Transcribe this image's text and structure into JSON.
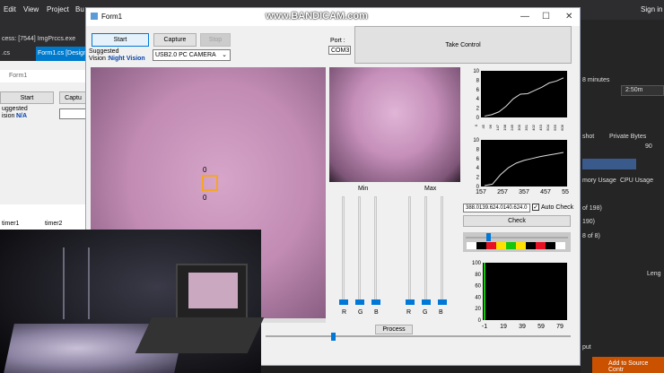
{
  "watermark": "www.BANDICAM.com",
  "ide": {
    "menu": [
      "Edit",
      "View",
      "Project",
      "Bu"
    ],
    "sign_in": "Sign in",
    "process_text": "cess:  [7544] ImgPrccs.exe",
    "tab_cs": ".cs",
    "tab_design": "Form1.cs [Design",
    "mini_form_title": "Form1",
    "mini_start": "Start",
    "mini_capt": "Captu",
    "mini_suggested": "uggested",
    "mini_vision": "ision :",
    "mini_na": "N/A",
    "timer1": "timer1",
    "timer2": "timer2",
    "minutes": "8 minutes",
    "time_value": "2:50m",
    "snapshot": "shot",
    "private_bytes": "Private Bytes",
    "value_90": "90",
    "memory_usage": "mory Usage",
    "cpu_usage": "CPU Usage",
    "of_198": "of 198)",
    "n190": "190)",
    "of_8": "8 of 8)",
    "put": "put",
    "add_source": "Add to Source Contr",
    "leng": "Leng"
  },
  "form": {
    "title": "Form1",
    "start": "Start",
    "capture": "Capture",
    "stop": "Stop",
    "port_label": "Port :",
    "port_value": "COM3",
    "take_control": "Take Control",
    "suggested_label": "Suggested",
    "vision_label": "Vision :",
    "suggested_value": "Night Vision",
    "camera_select": "USB2.0 PC CAMERA",
    "marker_top": "0",
    "marker_bottom": "0",
    "min_label": "Min",
    "max_label": "Max",
    "rgb_min": [
      "R",
      "G",
      "B"
    ],
    "rgb_max": [
      "R",
      "G",
      "B"
    ],
    "rgb_values": "388.0139.624.0140.624.0",
    "auto_check": "Auto Check",
    "check": "Check",
    "process": "Process",
    "strip_colors": [
      "#ffffff",
      "#000000",
      "#e81123",
      "#ffe100",
      "#16c60c",
      "#ffe100",
      "#000000",
      "#e81123",
      "#000000",
      "#ffffff"
    ]
  },
  "chart_data": [
    {
      "type": "line",
      "title": "",
      "y_ticks": [
        "10",
        "8",
        "6",
        "4",
        "2",
        "0"
      ],
      "x_ticks": [
        "0",
        "45",
        "96",
        "147",
        "198",
        "249",
        "300",
        "351",
        "402",
        "453",
        "504",
        "555",
        "606"
      ],
      "ylim": [
        0,
        10
      ],
      "series": [
        {
          "values_y": [
            0.3,
            0.6,
            1.2,
            2.4,
            4.0,
            5.0,
            5.1,
            5.8,
            6.5,
            7.4,
            7.8,
            8.5
          ]
        }
      ]
    },
    {
      "type": "line",
      "title": "",
      "y_ticks": [
        "10",
        "8",
        "6",
        "4",
        "2",
        "0"
      ],
      "x_ticks": [
        "157",
        "257",
        "357",
        "457",
        "557"
      ],
      "ylim": [
        0,
        10
      ],
      "series": [
        {
          "values_y": [
            0.2,
            0.5,
            2.5,
            4.0,
            5.0,
            5.6,
            6.0,
            6.4,
            6.7,
            7.0,
            7.3
          ]
        }
      ]
    },
    {
      "type": "line",
      "title": "",
      "y_ticks": [
        "100",
        "80",
        "60",
        "40",
        "20",
        "0"
      ],
      "x_ticks": [
        "-1",
        "19",
        "39",
        "59",
        "79"
      ],
      "ylim": [
        0,
        100
      ],
      "series": [
        {
          "values_y": [
            100,
            0
          ]
        }
      ]
    }
  ]
}
